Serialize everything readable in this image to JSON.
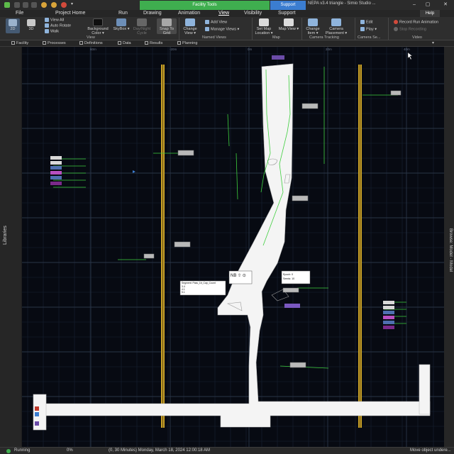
{
  "window": {
    "contextual_tab": "Facility Tools",
    "support_tab": "Support",
    "title": "NEPA v3.4 triangle - Simio Studio ...",
    "help": "Help"
  },
  "menu": {
    "tabs": [
      "File",
      "Project Home",
      "Run",
      "Drawing",
      "Animation",
      "View",
      "Visibility",
      "Support"
    ],
    "active": "View"
  },
  "ribbon": {
    "b2d": "2D",
    "b3d": "3D",
    "view_all": "View All",
    "auto_rotate": "Auto Rotate",
    "walk": "Walk",
    "background_color": "Background Color ▾",
    "skybox": "SkyBox ▾",
    "day_night": "Day/Night Cycle",
    "snap_grid": "Snap To Grid",
    "change_view": "Change View ▾",
    "add_view": "Add View",
    "manage_views": "Manage Views ▾",
    "set_map": "Set Map Location ▾",
    "map_view": "Map View ▾",
    "change_item": "Change Item ▾",
    "camera_placement": "Camera Placement ▾",
    "edit": "Edit",
    "play": "Play ▾",
    "record": "Record Run Animation",
    "stop_recording": "Stop Recording",
    "groups": {
      "view": "View",
      "named_views": "Named Views",
      "map": "Map",
      "camera_tracking": "Camera Tracking",
      "camera_se": "Camera Se...",
      "video": "Video"
    }
  },
  "panel_tabs": [
    "Facility",
    "Processes",
    "Definitions",
    "Data",
    "Results",
    "Planning"
  ],
  "side": {
    "libraries": "Libraries",
    "browse": "Browse: Model - Model"
  },
  "viewport": {
    "ruler": [
      "-20m",
      "0m",
      "20m",
      "40m",
      "60m",
      "80m"
    ],
    "callout_a": {
      "lines": [
        "Segment: Pass_1b_Cap_Count",
        "3.4",
        "4.1",
        "5.1"
      ]
    },
    "callout_b": {
      "lines": [
        "Epoch: 0",
        "Seeds: 10"
      ]
    },
    "nb_label": "NB ⇧ ⊙"
  },
  "status": {
    "state": "Running",
    "progress": "0%",
    "time": "(0, 30 Minutes) Monday, March 18, 2024 12:00:18 AM",
    "hint": "Move object undere..."
  },
  "colors": {
    "accent_green": "#3fae4f",
    "support_blue": "#3b7dd0",
    "grid": "#1c2430",
    "path_yellow": "#c9a227",
    "link_green": "#3ecf3e",
    "queue_purple": "#6b4ca8"
  }
}
